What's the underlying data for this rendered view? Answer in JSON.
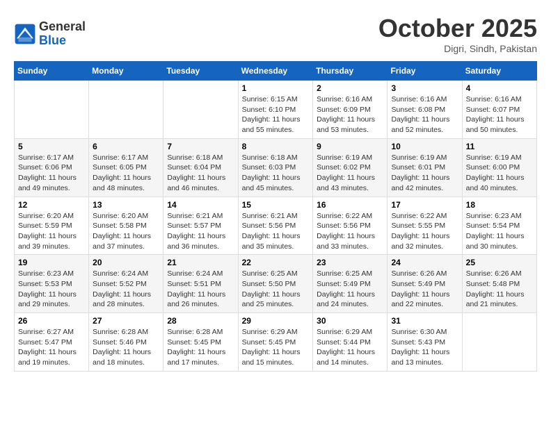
{
  "logo": {
    "general": "General",
    "blue": "Blue"
  },
  "title": "October 2025",
  "location": "Digri, Sindh, Pakistan",
  "weekdays": [
    "Sunday",
    "Monday",
    "Tuesday",
    "Wednesday",
    "Thursday",
    "Friday",
    "Saturday"
  ],
  "weeks": [
    [
      {
        "day": "",
        "content": ""
      },
      {
        "day": "",
        "content": ""
      },
      {
        "day": "",
        "content": ""
      },
      {
        "day": "1",
        "content": "Sunrise: 6:15 AM\nSunset: 6:10 PM\nDaylight: 11 hours\nand 55 minutes."
      },
      {
        "day": "2",
        "content": "Sunrise: 6:16 AM\nSunset: 6:09 PM\nDaylight: 11 hours\nand 53 minutes."
      },
      {
        "day": "3",
        "content": "Sunrise: 6:16 AM\nSunset: 6:08 PM\nDaylight: 11 hours\nand 52 minutes."
      },
      {
        "day": "4",
        "content": "Sunrise: 6:16 AM\nSunset: 6:07 PM\nDaylight: 11 hours\nand 50 minutes."
      }
    ],
    [
      {
        "day": "5",
        "content": "Sunrise: 6:17 AM\nSunset: 6:06 PM\nDaylight: 11 hours\nand 49 minutes."
      },
      {
        "day": "6",
        "content": "Sunrise: 6:17 AM\nSunset: 6:05 PM\nDaylight: 11 hours\nand 48 minutes."
      },
      {
        "day": "7",
        "content": "Sunrise: 6:18 AM\nSunset: 6:04 PM\nDaylight: 11 hours\nand 46 minutes."
      },
      {
        "day": "8",
        "content": "Sunrise: 6:18 AM\nSunset: 6:03 PM\nDaylight: 11 hours\nand 45 minutes."
      },
      {
        "day": "9",
        "content": "Sunrise: 6:19 AM\nSunset: 6:02 PM\nDaylight: 11 hours\nand 43 minutes."
      },
      {
        "day": "10",
        "content": "Sunrise: 6:19 AM\nSunset: 6:01 PM\nDaylight: 11 hours\nand 42 minutes."
      },
      {
        "day": "11",
        "content": "Sunrise: 6:19 AM\nSunset: 6:00 PM\nDaylight: 11 hours\nand 40 minutes."
      }
    ],
    [
      {
        "day": "12",
        "content": "Sunrise: 6:20 AM\nSunset: 5:59 PM\nDaylight: 11 hours\nand 39 minutes."
      },
      {
        "day": "13",
        "content": "Sunrise: 6:20 AM\nSunset: 5:58 PM\nDaylight: 11 hours\nand 37 minutes."
      },
      {
        "day": "14",
        "content": "Sunrise: 6:21 AM\nSunset: 5:57 PM\nDaylight: 11 hours\nand 36 minutes."
      },
      {
        "day": "15",
        "content": "Sunrise: 6:21 AM\nSunset: 5:56 PM\nDaylight: 11 hours\nand 35 minutes."
      },
      {
        "day": "16",
        "content": "Sunrise: 6:22 AM\nSunset: 5:56 PM\nDaylight: 11 hours\nand 33 minutes."
      },
      {
        "day": "17",
        "content": "Sunrise: 6:22 AM\nSunset: 5:55 PM\nDaylight: 11 hours\nand 32 minutes."
      },
      {
        "day": "18",
        "content": "Sunrise: 6:23 AM\nSunset: 5:54 PM\nDaylight: 11 hours\nand 30 minutes."
      }
    ],
    [
      {
        "day": "19",
        "content": "Sunrise: 6:23 AM\nSunset: 5:53 PM\nDaylight: 11 hours\nand 29 minutes."
      },
      {
        "day": "20",
        "content": "Sunrise: 6:24 AM\nSunset: 5:52 PM\nDaylight: 11 hours\nand 28 minutes."
      },
      {
        "day": "21",
        "content": "Sunrise: 6:24 AM\nSunset: 5:51 PM\nDaylight: 11 hours\nand 26 minutes."
      },
      {
        "day": "22",
        "content": "Sunrise: 6:25 AM\nSunset: 5:50 PM\nDaylight: 11 hours\nand 25 minutes."
      },
      {
        "day": "23",
        "content": "Sunrise: 6:25 AM\nSunset: 5:49 PM\nDaylight: 11 hours\nand 24 minutes."
      },
      {
        "day": "24",
        "content": "Sunrise: 6:26 AM\nSunset: 5:49 PM\nDaylight: 11 hours\nand 22 minutes."
      },
      {
        "day": "25",
        "content": "Sunrise: 6:26 AM\nSunset: 5:48 PM\nDaylight: 11 hours\nand 21 minutes."
      }
    ],
    [
      {
        "day": "26",
        "content": "Sunrise: 6:27 AM\nSunset: 5:47 PM\nDaylight: 11 hours\nand 19 minutes."
      },
      {
        "day": "27",
        "content": "Sunrise: 6:28 AM\nSunset: 5:46 PM\nDaylight: 11 hours\nand 18 minutes."
      },
      {
        "day": "28",
        "content": "Sunrise: 6:28 AM\nSunset: 5:45 PM\nDaylight: 11 hours\nand 17 minutes."
      },
      {
        "day": "29",
        "content": "Sunrise: 6:29 AM\nSunset: 5:45 PM\nDaylight: 11 hours\nand 15 minutes."
      },
      {
        "day": "30",
        "content": "Sunrise: 6:29 AM\nSunset: 5:44 PM\nDaylight: 11 hours\nand 14 minutes."
      },
      {
        "day": "31",
        "content": "Sunrise: 6:30 AM\nSunset: 5:43 PM\nDaylight: 11 hours\nand 13 minutes."
      },
      {
        "day": "",
        "content": ""
      }
    ]
  ]
}
